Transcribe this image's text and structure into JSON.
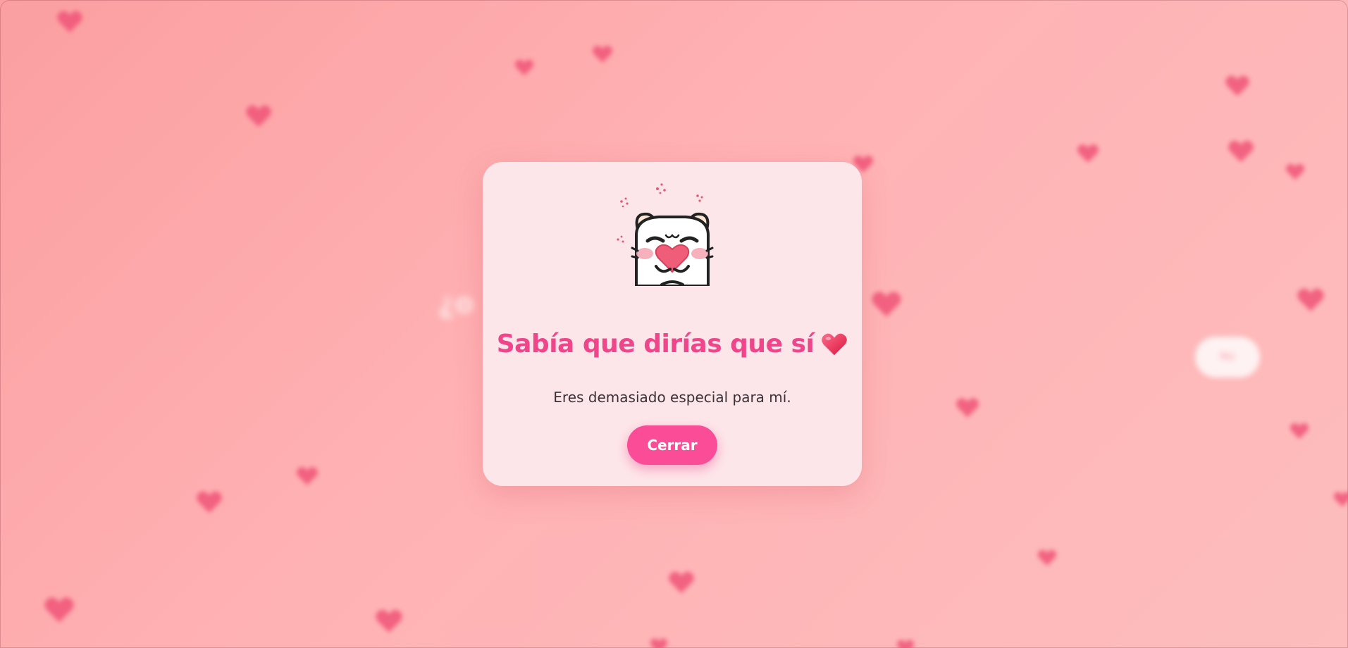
{
  "background": {
    "gradient_from": "#fb9fa1",
    "gradient_to": "#fdbdbd",
    "heart_color": "#f05478",
    "decoration_icon": "heart-icon",
    "blurred_text": "¿o",
    "blurred_button_label": "No"
  },
  "modal": {
    "sticker_icon": "bear-holding-heart-sticker",
    "title": "Sabía que dirías que sí",
    "title_emoji": "red-heart-emoji",
    "message": "Eres demasiado especial para mí.",
    "close_label": "Cerrar"
  },
  "colors": {
    "modal_bg": "#fde6ea",
    "accent": "#f0458b",
    "button_bg": "#fb4c97",
    "text": "#3b3236"
  }
}
